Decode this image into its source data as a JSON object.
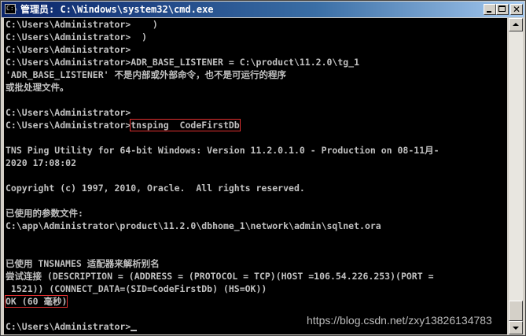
{
  "window": {
    "title": "管理员: C:\\Windows\\system32\\cmd.exe",
    "icon": "cmd-icon",
    "buttons": {
      "minimize": "minimize-icon",
      "maximize": "maximize-icon",
      "close": "close-icon"
    }
  },
  "console": {
    "lines": [
      "C:\\Users\\Administrator>    )",
      "C:\\Users\\Administrator>  )",
      "C:\\Users\\Administrator>",
      "C:\\Users\\Administrator>ADR_BASE_LISTENER = C:\\product\\11.2.0\\tg_1",
      "'ADR_BASE_LISTENER' 不是内部或外部命令，也不是可运行的程序",
      "或批处理文件。",
      "",
      "C:\\Users\\Administrator>",
      "",
      "",
      "TNS Ping Utility for 64-bit Windows: Version 11.2.0.1.0 - Production on 08-11月-",
      "2020 17:08:02",
      "",
      "Copyright (c) 1997, 2010, Oracle.  All rights reserved.",
      "",
      "已使用的参数文件:",
      "C:\\app\\Administrator\\product\\11.2.0\\dbhome_1\\network\\admin\\sqlnet.ora",
      "",
      "",
      "已使用 TNSNAMES 适配器来解析别名",
      "尝试连接 (DESCRIPTION = (ADDRESS = (PROTOCOL = TCP)(HOST =106.54.226.253)(PORT =",
      " 1521)) (CONNECT_DATA=(SID=CodeFirstDb) (HS=OK))",
      "",
      "",
      ""
    ],
    "prompt": "C:\\Users\\Administrator>",
    "tnsping_command": "tnsping  CodeFirstDb",
    "ok_result": "OK (60 毫秒)"
  },
  "watermark": "https://blog.csdn.net/zxy13826134783",
  "colors": {
    "console_bg": "#000000",
    "console_fg": "#c0c0c0",
    "highlight": "#e03030",
    "titlebar": "#0a246a"
  }
}
